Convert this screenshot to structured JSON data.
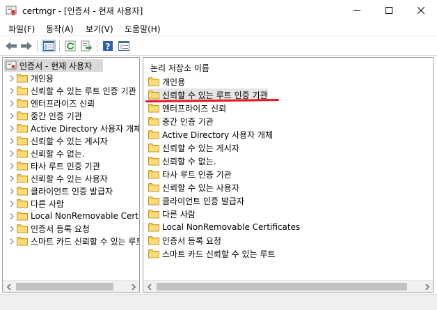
{
  "window": {
    "title": "certmgr - [인증서 - 현재 사용자]"
  },
  "menu": [
    {
      "label": "파일(F)"
    },
    {
      "label": "동작(A)"
    },
    {
      "label": "보기(V)"
    },
    {
      "label": "도움말(H)"
    }
  ],
  "toolbar": {
    "icons": [
      "back-icon",
      "forward-icon",
      "show-hide-console-tree-icon",
      "refresh-icon",
      "export-list-icon",
      "help-icon",
      "properties-icon"
    ]
  },
  "tree": {
    "root": "인증서 - 현재 사용자",
    "items": [
      "개인용",
      "신뢰할 수 있는 루트 인증 기관",
      "엔터프라이즈 신뢰",
      "중간 인증 기관",
      "Active Directory 사용자 개체",
      "신뢰할 수 있는 게시자",
      "신뢰할 수 없는.",
      "타사 루트 인증 기관",
      "신뢰할 수 있는 사용자",
      "클라이언트 인증 발급자",
      "다른 사람",
      "Local NonRemovable Certificates",
      "인증서 등록 요청",
      "스마트 카드 신뢰할 수 있는 루트"
    ]
  },
  "list": {
    "header": "논리 저장소 이름",
    "items": [
      "개인용",
      "신뢰할 수 있는 루트 인증 기관",
      "엔터프라이즈 신뢰",
      "중간 인증 기관",
      "Active Directory 사용자 개체",
      "신뢰할 수 있는 게시자",
      "신뢰할 수 없는.",
      "타사 루트 인증 기관",
      "신뢰할 수 있는 사용자",
      "클라이언트 인증 발급자",
      "다른 사람",
      "Local NonRemovable Certificates",
      "인증서 등록 요청",
      "스마트 카드 신뢰할 수 있는 루트"
    ],
    "selected_index": 1
  },
  "colors": {
    "annotation": "#e8141e",
    "folder": "#f5c94c",
    "selection": "#e5e5e5"
  }
}
